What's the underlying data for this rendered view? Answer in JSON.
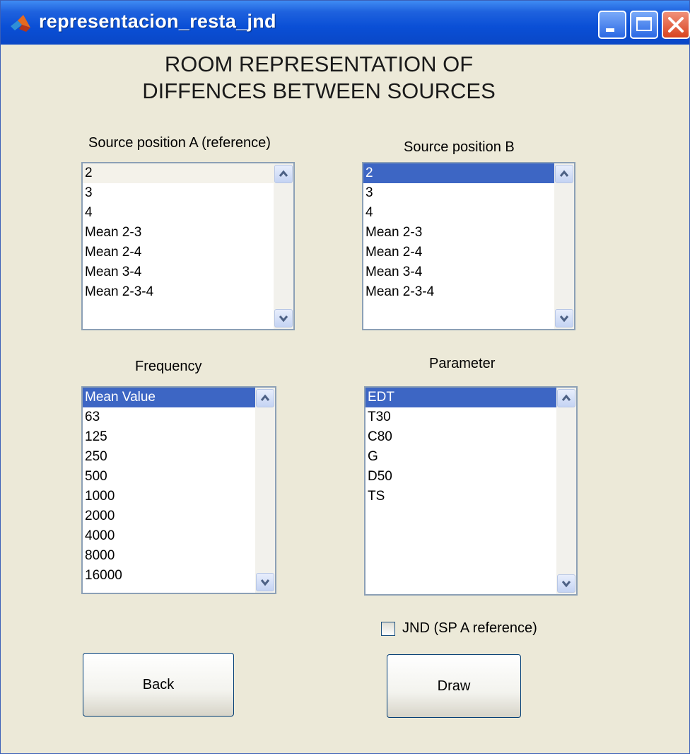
{
  "window": {
    "title": "representacion_resta_jnd",
    "controls": [
      "minimize-icon",
      "maximize-icon",
      "close-icon"
    ]
  },
  "heading": {
    "line1": "ROOM REPRESENTATION OF",
    "line2": "DIFFENCES BETWEEN SOURCES"
  },
  "source_a": {
    "label": "Source position A (reference)",
    "items": [
      "2",
      "3",
      "4",
      "Mean 2-3",
      "Mean 2-4",
      "Mean 3-4",
      "Mean 2-3-4"
    ],
    "selected": "2"
  },
  "source_b": {
    "label": "Source position B",
    "items": [
      "2",
      "3",
      "4",
      "Mean 2-3",
      "Mean 2-4",
      "Mean 3-4",
      "Mean 2-3-4"
    ],
    "selected": "2"
  },
  "frequency": {
    "label": "Frequency",
    "items": [
      "Mean Value",
      "63",
      "125",
      "250",
      "500",
      "1000",
      "2000",
      "4000",
      "8000",
      "16000"
    ],
    "selected": "Mean Value"
  },
  "parameter": {
    "label": "Parameter",
    "items": [
      "EDT",
      "T30",
      "C80",
      "G",
      "D50",
      "TS"
    ],
    "selected": "EDT"
  },
  "jnd_checkbox": {
    "label": "JND (SP A reference)",
    "checked": false
  },
  "buttons": {
    "back": "Back",
    "draw": "Draw"
  },
  "colors": {
    "title_bar": "#0a4fd6",
    "window_bg": "#ece9d8",
    "selection": "#3d66c4",
    "close_button": "#d8431f"
  }
}
